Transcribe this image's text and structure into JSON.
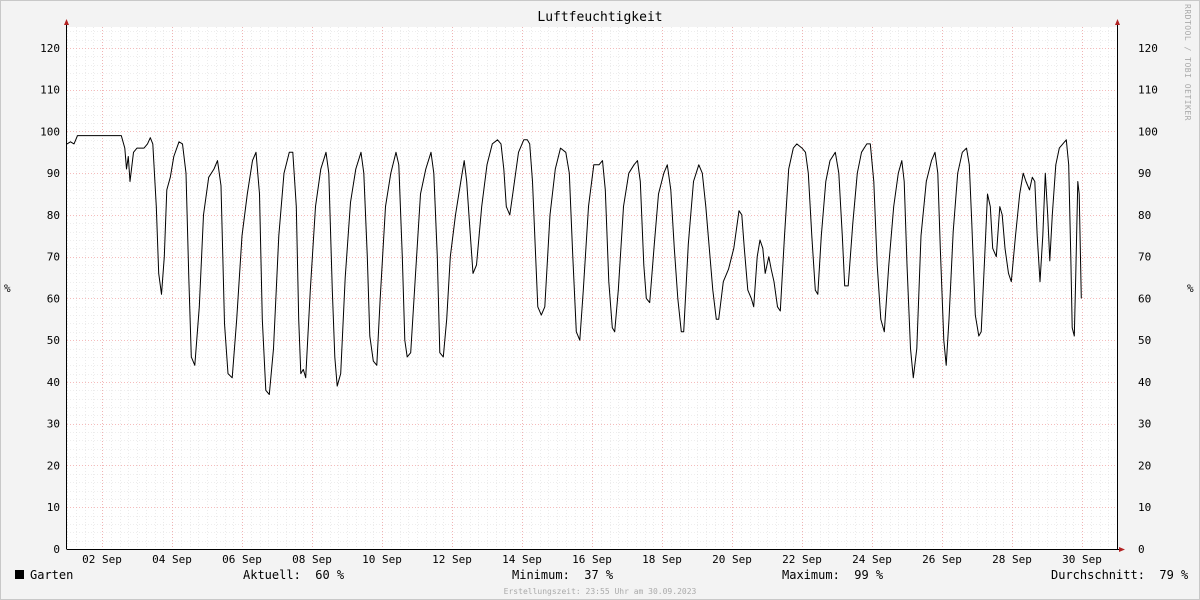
{
  "chart_data": {
    "type": "line",
    "title": "Luftfeuchtigkeit",
    "ylabel": "%",
    "ylim": [
      0,
      125
    ],
    "yticks": [
      0,
      10,
      20,
      30,
      40,
      50,
      60,
      70,
      80,
      90,
      100,
      110,
      120
    ],
    "x_range_days": [
      "2023-09-01T00:00",
      "2023-10-01T00:00"
    ],
    "xtick_days": [
      2,
      4,
      6,
      8,
      10,
      12,
      14,
      16,
      18,
      20,
      22,
      24,
      26,
      28,
      30
    ],
    "xtick_labels": [
      "02 Sep",
      "04 Sep",
      "06 Sep",
      "08 Sep",
      "10 Sep",
      "12 Sep",
      "14 Sep",
      "16 Sep",
      "18 Sep",
      "20 Sep",
      "22 Sep",
      "24 Sep",
      "26 Sep",
      "28 Sep",
      "30 Sep"
    ],
    "grid": true,
    "series": [
      {
        "name": "Garten",
        "color": "#000000",
        "points": [
          [
            1.0,
            97
          ],
          [
            1.1,
            97.5
          ],
          [
            1.2,
            97
          ],
          [
            1.3,
            99
          ],
          [
            1.5,
            99
          ],
          [
            1.8,
            99
          ],
          [
            2.2,
            99
          ],
          [
            2.55,
            99
          ],
          [
            2.65,
            96
          ],
          [
            2.7,
            91
          ],
          [
            2.75,
            94
          ],
          [
            2.8,
            88
          ],
          [
            2.9,
            95
          ],
          [
            3.0,
            96
          ],
          [
            3.2,
            96
          ],
          [
            3.3,
            97
          ],
          [
            3.38,
            98.5
          ],
          [
            3.45,
            97
          ],
          [
            3.55,
            82
          ],
          [
            3.62,
            66
          ],
          [
            3.7,
            61
          ],
          [
            3.78,
            70
          ],
          [
            3.85,
            86
          ],
          [
            3.95,
            89
          ],
          [
            4.05,
            94
          ],
          [
            4.2,
            97.5
          ],
          [
            4.3,
            97
          ],
          [
            4.4,
            90
          ],
          [
            4.48,
            65
          ],
          [
            4.55,
            46
          ],
          [
            4.65,
            44
          ],
          [
            4.78,
            58
          ],
          [
            4.9,
            80
          ],
          [
            5.05,
            89
          ],
          [
            5.2,
            91
          ],
          [
            5.3,
            93
          ],
          [
            5.4,
            87
          ],
          [
            5.5,
            54
          ],
          [
            5.6,
            42
          ],
          [
            5.72,
            41
          ],
          [
            5.85,
            55
          ],
          [
            6.0,
            75
          ],
          [
            6.15,
            85
          ],
          [
            6.3,
            93
          ],
          [
            6.4,
            95
          ],
          [
            6.5,
            85
          ],
          [
            6.58,
            55
          ],
          [
            6.68,
            38
          ],
          [
            6.78,
            37
          ],
          [
            6.9,
            48
          ],
          [
            7.05,
            75
          ],
          [
            7.2,
            90
          ],
          [
            7.35,
            95
          ],
          [
            7.45,
            95
          ],
          [
            7.55,
            82
          ],
          [
            7.62,
            55
          ],
          [
            7.68,
            42
          ],
          [
            7.75,
            43
          ],
          [
            7.82,
            41
          ],
          [
            7.95,
            62
          ],
          [
            8.1,
            82
          ],
          [
            8.25,
            91
          ],
          [
            8.4,
            95
          ],
          [
            8.48,
            90
          ],
          [
            8.58,
            62
          ],
          [
            8.65,
            46
          ],
          [
            8.72,
            39
          ],
          [
            8.82,
            42
          ],
          [
            8.95,
            65
          ],
          [
            9.1,
            83
          ],
          [
            9.25,
            91
          ],
          [
            9.4,
            95
          ],
          [
            9.48,
            90
          ],
          [
            9.58,
            70
          ],
          [
            9.65,
            51
          ],
          [
            9.75,
            45
          ],
          [
            9.85,
            44
          ],
          [
            9.95,
            60
          ],
          [
            10.1,
            82
          ],
          [
            10.25,
            90
          ],
          [
            10.4,
            95
          ],
          [
            10.48,
            92
          ],
          [
            10.58,
            70
          ],
          [
            10.65,
            50
          ],
          [
            10.72,
            46
          ],
          [
            10.82,
            47
          ],
          [
            10.95,
            65
          ],
          [
            11.1,
            85
          ],
          [
            11.25,
            91
          ],
          [
            11.4,
            95
          ],
          [
            11.48,
            90
          ],
          [
            11.58,
            70
          ],
          [
            11.65,
            47
          ],
          [
            11.75,
            46
          ],
          [
            11.85,
            55
          ],
          [
            11.95,
            70
          ],
          [
            12.1,
            80
          ],
          [
            12.25,
            88
          ],
          [
            12.35,
            93
          ],
          [
            12.42,
            88
          ],
          [
            12.5,
            78
          ],
          [
            12.6,
            66
          ],
          [
            12.7,
            68
          ],
          [
            12.85,
            82
          ],
          [
            13.0,
            92
          ],
          [
            13.15,
            97
          ],
          [
            13.3,
            98
          ],
          [
            13.4,
            97
          ],
          [
            13.48,
            91
          ],
          [
            13.55,
            82
          ],
          [
            13.65,
            80
          ],
          [
            13.75,
            86
          ],
          [
            13.9,
            95
          ],
          [
            14.05,
            98
          ],
          [
            14.15,
            98
          ],
          [
            14.22,
            97
          ],
          [
            14.3,
            88
          ],
          [
            14.38,
            72
          ],
          [
            14.45,
            58
          ],
          [
            14.55,
            56
          ],
          [
            14.65,
            58
          ],
          [
            14.8,
            80
          ],
          [
            14.95,
            91
          ],
          [
            15.1,
            96
          ],
          [
            15.25,
            95
          ],
          [
            15.35,
            90
          ],
          [
            15.45,
            70
          ],
          [
            15.55,
            52
          ],
          [
            15.65,
            50
          ],
          [
            15.75,
            62
          ],
          [
            15.9,
            82
          ],
          [
            16.05,
            92
          ],
          [
            16.2,
            92
          ],
          [
            16.3,
            93
          ],
          [
            16.38,
            86
          ],
          [
            16.48,
            64
          ],
          [
            16.58,
            53
          ],
          [
            16.65,
            52
          ],
          [
            16.75,
            62
          ],
          [
            16.9,
            82
          ],
          [
            17.05,
            90
          ],
          [
            17.2,
            92
          ],
          [
            17.3,
            93
          ],
          [
            17.38,
            88
          ],
          [
            17.48,
            68
          ],
          [
            17.55,
            60
          ],
          [
            17.65,
            59
          ],
          [
            17.78,
            73
          ],
          [
            17.9,
            85
          ],
          [
            18.05,
            90
          ],
          [
            18.15,
            92
          ],
          [
            18.25,
            86
          ],
          [
            18.35,
            72
          ],
          [
            18.45,
            60
          ],
          [
            18.55,
            52
          ],
          [
            18.62,
            52
          ],
          [
            18.75,
            73
          ],
          [
            18.9,
            88
          ],
          [
            19.05,
            92
          ],
          [
            19.15,
            90
          ],
          [
            19.25,
            82
          ],
          [
            19.35,
            72
          ],
          [
            19.45,
            62
          ],
          [
            19.55,
            55
          ],
          [
            19.62,
            55
          ],
          [
            19.75,
            64
          ],
          [
            19.9,
            67
          ],
          [
            20.05,
            72
          ],
          [
            20.2,
            81
          ],
          [
            20.28,
            80
          ],
          [
            20.35,
            72
          ],
          [
            20.45,
            62
          ],
          [
            20.55,
            60
          ],
          [
            20.62,
            58
          ],
          [
            20.72,
            70
          ],
          [
            20.8,
            74
          ],
          [
            20.88,
            72
          ],
          [
            20.95,
            66
          ],
          [
            21.05,
            70
          ],
          [
            21.12,
            67
          ],
          [
            21.2,
            64
          ],
          [
            21.3,
            58
          ],
          [
            21.38,
            57
          ],
          [
            21.5,
            75
          ],
          [
            21.62,
            91
          ],
          [
            21.75,
            96
          ],
          [
            21.85,
            97
          ],
          [
            22.0,
            96
          ],
          [
            22.1,
            95
          ],
          [
            22.18,
            90
          ],
          [
            22.28,
            75
          ],
          [
            22.38,
            62
          ],
          [
            22.45,
            61
          ],
          [
            22.55,
            75
          ],
          [
            22.68,
            88
          ],
          [
            22.8,
            93
          ],
          [
            22.95,
            95
          ],
          [
            23.05,
            90
          ],
          [
            23.15,
            75
          ],
          [
            23.22,
            63
          ],
          [
            23.32,
            63
          ],
          [
            23.45,
            78
          ],
          [
            23.58,
            90
          ],
          [
            23.7,
            95
          ],
          [
            23.85,
            97
          ],
          [
            23.95,
            97
          ],
          [
            24.05,
            88
          ],
          [
            24.15,
            68
          ],
          [
            24.25,
            55
          ],
          [
            24.35,
            52
          ],
          [
            24.48,
            68
          ],
          [
            24.62,
            82
          ],
          [
            24.75,
            90
          ],
          [
            24.85,
            93
          ],
          [
            24.92,
            88
          ],
          [
            25.0,
            68
          ],
          [
            25.1,
            48
          ],
          [
            25.18,
            41
          ],
          [
            25.28,
            48
          ],
          [
            25.4,
            75
          ],
          [
            25.55,
            88
          ],
          [
            25.7,
            93
          ],
          [
            25.8,
            95
          ],
          [
            25.88,
            90
          ],
          [
            25.95,
            72
          ],
          [
            26.05,
            50
          ],
          [
            26.12,
            44
          ],
          [
            26.2,
            55
          ],
          [
            26.32,
            76
          ],
          [
            26.45,
            90
          ],
          [
            26.58,
            95
          ],
          [
            26.7,
            96
          ],
          [
            26.78,
            92
          ],
          [
            26.85,
            78
          ],
          [
            26.95,
            56
          ],
          [
            27.05,
            51
          ],
          [
            27.12,
            52
          ],
          [
            27.22,
            70
          ],
          [
            27.3,
            85
          ],
          [
            27.38,
            82
          ],
          [
            27.45,
            72
          ],
          [
            27.55,
            70
          ],
          [
            27.65,
            82
          ],
          [
            27.72,
            80
          ],
          [
            27.8,
            72
          ],
          [
            27.9,
            66
          ],
          [
            27.98,
            64
          ],
          [
            28.1,
            75
          ],
          [
            28.22,
            85
          ],
          [
            28.32,
            90
          ],
          [
            28.4,
            88
          ],
          [
            28.5,
            86
          ],
          [
            28.58,
            89
          ],
          [
            28.65,
            88
          ],
          [
            28.72,
            75
          ],
          [
            28.8,
            64
          ],
          [
            28.88,
            75
          ],
          [
            28.95,
            90
          ],
          [
            29.02,
            80
          ],
          [
            29.08,
            69
          ],
          [
            29.15,
            80
          ],
          [
            29.25,
            92
          ],
          [
            29.35,
            96
          ],
          [
            29.45,
            97
          ],
          [
            29.55,
            98
          ],
          [
            29.62,
            92
          ],
          [
            29.68,
            70
          ],
          [
            29.72,
            53
          ],
          [
            29.78,
            51
          ],
          [
            29.82,
            65
          ],
          [
            29.88,
            88
          ],
          [
            29.92,
            85
          ],
          [
            29.98,
            60
          ]
        ]
      }
    ]
  },
  "watermark": "RRDTOOL / TOBI OETIKER",
  "legend": {
    "series_name": "Garten",
    "current_label": "Aktuell:",
    "current_value": "60 %",
    "min_label": "Minimum:",
    "min_value": "37 %",
    "max_label": "Maximum:",
    "max_value": "99 %",
    "avg_label": "Durchschnitt:",
    "avg_value": "79 %"
  },
  "footer": "Erstellungszeit: 23:55 Uhr am 30.09.2023"
}
